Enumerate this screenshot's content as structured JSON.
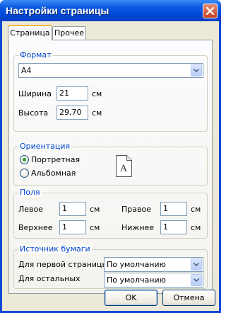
{
  "window": {
    "title": "Настройки страницы"
  },
  "tabs": [
    {
      "label": "Страница",
      "active": true
    },
    {
      "label": "Прочее",
      "active": false
    }
  ],
  "format": {
    "legend": "Формат",
    "paper_size": "A4",
    "width_label": "Ширина",
    "width_value": "21",
    "width_unit": "см",
    "height_label": "Высота",
    "height_value": "29,70",
    "height_unit": "см"
  },
  "orientation": {
    "legend": "Ориентация",
    "portrait_label": "Портретная",
    "landscape_label": "Альбомная",
    "selected": "portrait",
    "preview_letter": "A"
  },
  "margins": {
    "legend": "Поля",
    "left_label": "Левое",
    "left_value": "1",
    "left_unit": "см",
    "right_label": "Правое",
    "right_value": "1",
    "right_unit": "см",
    "top_label": "Верхнее",
    "top_value": "1",
    "top_unit": "см",
    "bottom_label": "Нижнее",
    "bottom_value": "1",
    "bottom_unit": "см"
  },
  "paper_source": {
    "legend": "Источник бумаги",
    "first_page_label": "Для первой страницы",
    "first_page_value": "По умолчанию",
    "others_label": "Для остальных",
    "others_value": "По умолчанию"
  },
  "buttons": {
    "ok": "OK",
    "cancel": "Отмена"
  },
  "colors": {
    "legend_text": "#0046d5",
    "titlebar": "#0a5ae0",
    "face": "#ece9d8",
    "close": "#c5401f"
  }
}
